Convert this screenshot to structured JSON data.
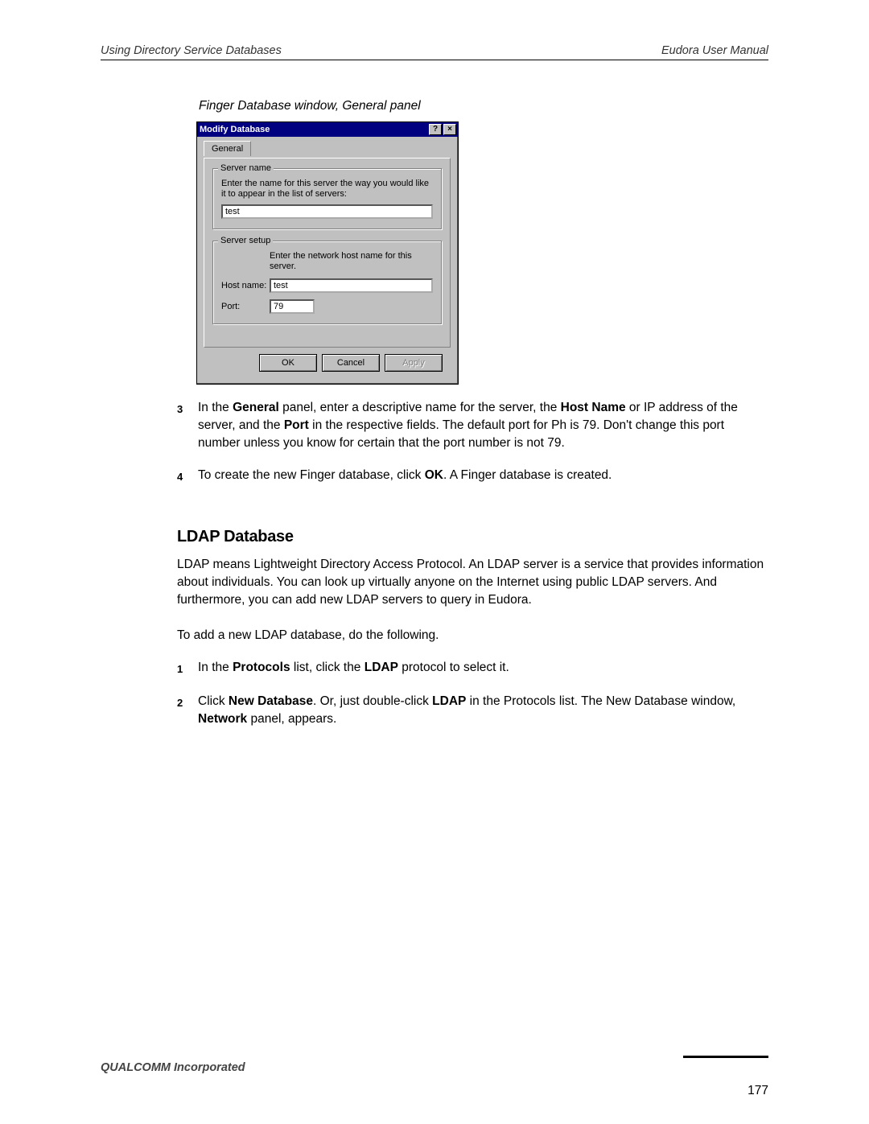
{
  "header": {
    "left": "Using Directory Service Databases",
    "right": "Eudora User Manual"
  },
  "figure_caption": "Finger Database window, General panel",
  "dialog": {
    "title": "Modify Database",
    "help_glyph": "?",
    "close_glyph": "×",
    "tab_label": "General",
    "server_name": {
      "legend": "Server name",
      "help": "Enter the name for this server the way you would like it to appear in the list of servers:",
      "value": "test"
    },
    "server_setup": {
      "legend": "Server setup",
      "help": "Enter the network host name for this server.",
      "host_label": "Host name:",
      "host_value": "test",
      "port_label": "Port:",
      "port_value": "79"
    },
    "buttons": {
      "ok": "OK",
      "cancel": "Cancel",
      "apply": "Apply"
    }
  },
  "steps_a": [
    {
      "num": "3",
      "parts": [
        "In the ",
        "General",
        " panel, enter a descriptive name for the server, the ",
        "Host Name",
        " or IP address of the server, and the ",
        "Port",
        " in the respective fields. The default port for Ph is 79. Don't change this port number unless you know for certain that the port number is not 79."
      ]
    },
    {
      "num": "4",
      "parts": [
        "To create the new Finger database, click ",
        "OK",
        ". A Finger database is created."
      ]
    }
  ],
  "section_title": "LDAP Database",
  "para1": "LDAP means Lightweight Directory Access Protocol. An LDAP server is a service that provides information about individuals. You can look up virtually anyone on the Internet using public LDAP servers. And furthermore, you can add new LDAP servers to query in Eudora.",
  "para2": "To add a new LDAP database, do the following.",
  "steps_b": [
    {
      "num": "1",
      "parts": [
        "In the ",
        "Protocols",
        " list, click the ",
        "LDAP",
        " protocol to select it."
      ]
    },
    {
      "num": "2",
      "parts": [
        "Click ",
        "New Database",
        ". Or, just double-click ",
        "LDAP",
        " in the Protocols list. The New Database window, ",
        "Network",
        " panel, appears."
      ]
    }
  ],
  "footer": {
    "company": "QUALCOMM Incorporated",
    "page": "177"
  }
}
